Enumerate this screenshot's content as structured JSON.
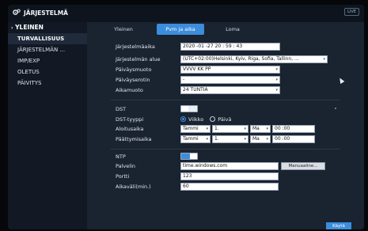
{
  "app_title": "JÄRJESTELMÄ",
  "live_badge": "LIVE",
  "sidebar": {
    "items": [
      {
        "label": "YLEINEN",
        "header": true
      },
      {
        "label": "TURVALLISUUS",
        "selected": true
      },
      {
        "label": "JÄRJESTELMÄN ..."
      },
      {
        "label": "IMP/EXP"
      },
      {
        "label": "OLETUS"
      },
      {
        "label": "PÄIVITYS"
      }
    ]
  },
  "tabs": [
    {
      "label": "Yleinen"
    },
    {
      "label": "Pvm ja aika",
      "active": true
    },
    {
      "label": "Loma"
    }
  ],
  "settings": {
    "system_time_label": "Järjestelmäaika",
    "system_time_value": "2020 -01 -27    20 : 59 : 43",
    "timezone_label": "Järjestelmän alue",
    "timezone_value": "(UTC+02:00)Helsinki, Kyiv, Riga, Sofia, Tallinn, ...",
    "date_format_label": "Päiväysmuoto",
    "date_format_value": "VVVV KK PP",
    "date_separator_label": "Päiväyserotin",
    "date_separator_value": "-",
    "time_format_label": "Aikamuoto",
    "time_format_value": "24 TUNTIA"
  },
  "dst": {
    "dst_label": "DST",
    "dst_enabled": false,
    "dst_type_label": "DST-tyyppi",
    "week_label": "Viikko",
    "day_label": "Päivä",
    "selected_type": "Viikko",
    "start_label": "Aloitusaika",
    "start_month": "Tammi",
    "start_week": "1.",
    "start_day": "Ma",
    "start_time": "00 :00",
    "end_label": "Päättymisaika",
    "end_month": "Tammi",
    "end_week": "1.",
    "end_day": "Ma",
    "end_time": "00 :00"
  },
  "ntp": {
    "ntp_label": "NTP",
    "ntp_enabled": true,
    "server_label": "Palvelin",
    "server_value": "time.windows.com",
    "manual_button": "Manuaaline...",
    "port_label": "Portti",
    "port_value": "123",
    "interval_label": "Aikaväli(min.)",
    "interval_value": "60"
  },
  "apply_button": "Käytä",
  "colors": {
    "accent": "#3c8ddc",
    "background": "#1a2330",
    "sidebar": "#121924"
  }
}
